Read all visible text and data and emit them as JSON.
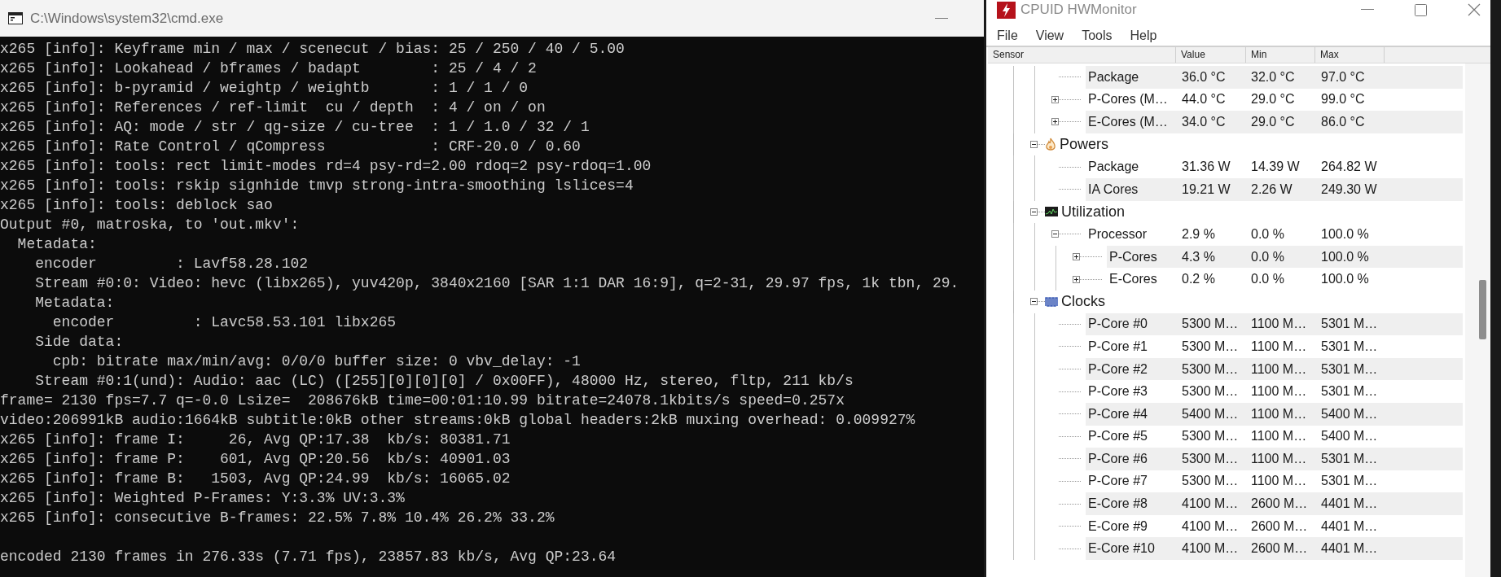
{
  "console": {
    "title": "C:\\Windows\\system32\\cmd.exe",
    "output": [
      "x265 [info]: Keyframe min / max / scenecut / bias: 25 / 250 / 40 / 5.00",
      "x265 [info]: Lookahead / bframes / badapt        : 25 / 4 / 2",
      "x265 [info]: b-pyramid / weightp / weightb       : 1 / 1 / 0",
      "x265 [info]: References / ref-limit  cu / depth  : 4 / on / on",
      "x265 [info]: AQ: mode / str / qg-size / cu-tree  : 1 / 1.0 / 32 / 1",
      "x265 [info]: Rate Control / qCompress            : CRF-20.0 / 0.60",
      "x265 [info]: tools: rect limit-modes rd=4 psy-rd=2.00 rdoq=2 psy-rdoq=1.00",
      "x265 [info]: tools: rskip signhide tmvp strong-intra-smoothing lslices=4",
      "x265 [info]: tools: deblock sao",
      "Output #0, matroska, to 'out.mkv':",
      "  Metadata:",
      "    encoder         : Lavf58.28.102",
      "    Stream #0:0: Video: hevc (libx265), yuv420p, 3840x2160 [SAR 1:1 DAR 16:9], q=2-31, 29.97 fps, 1k tbn, 29.",
      "    Metadata:",
      "      encoder         : Lavc58.53.101 libx265",
      "    Side data:",
      "      cpb: bitrate max/min/avg: 0/0/0 buffer size: 0 vbv_delay: -1",
      "    Stream #0:1(und): Audio: aac (LC) ([255][0][0][0] / 0x00FF), 48000 Hz, stereo, fltp, 211 kb/s",
      "frame= 2130 fps=7.7 q=-0.0 Lsize=  208676kB time=00:01:10.99 bitrate=24078.1kbits/s speed=0.257x",
      "video:206991kB audio:1664kB subtitle:0kB other streams:0kB global headers:2kB muxing overhead: 0.009927%",
      "x265 [info]: frame I:     26, Avg QP:17.38  kb/s: 80381.71",
      "x265 [info]: frame P:    601, Avg QP:20.56  kb/s: 40901.03",
      "x265 [info]: frame B:   1503, Avg QP:24.99  kb/s: 16065.02",
      "x265 [info]: Weighted P-Frames: Y:3.3% UV:3.3%",
      "x265 [info]: consecutive B-frames: 22.5% 7.8% 10.4% 26.2% 33.2%"
    ],
    "summary": "encoded 2130 frames in 276.33s (7.71 fps), 23857.83 kb/s, Avg QP:23.64"
  },
  "hwmonitor": {
    "title": "CPUID HWMonitor",
    "menu": [
      "File",
      "View",
      "Tools",
      "Help"
    ],
    "columns": [
      "Sensor",
      "Value",
      "Min",
      "Max"
    ],
    "tree": [
      {
        "kind": "continued",
        "children": [
          {
            "label": "Package",
            "value": "36.0 °C",
            "min": "32.0 °C",
            "max": "97.0 °C"
          },
          {
            "label": "P-Cores (M…",
            "value": "44.0 °C",
            "min": "29.0 °C",
            "max": "99.0 °C",
            "expanded": false
          },
          {
            "label": "E-Cores (M…",
            "value": "34.0 °C",
            "min": "29.0 °C",
            "max": "86.0 °C",
            "expanded": false
          }
        ]
      },
      {
        "kind": "power",
        "label": "Powers",
        "expanded": true,
        "children": [
          {
            "label": "Package",
            "value": "31.36 W",
            "min": "14.39 W",
            "max": "264.82 W"
          },
          {
            "label": "IA Cores",
            "value": "19.21 W",
            "min": "2.26 W",
            "max": "249.30 W"
          }
        ]
      },
      {
        "kind": "utilization",
        "label": "Utilization",
        "expanded": true,
        "children": [
          {
            "label": "Processor",
            "value": "2.9 %",
            "min": "0.0 %",
            "max": "100.0 %",
            "expanded": true,
            "children": [
              {
                "label": "P-Cores",
                "value": "4.3 %",
                "min": "0.0 %",
                "max": "100.0 %",
                "expanded": false
              },
              {
                "label": "E-Cores",
                "value": "0.2 %",
                "min": "0.0 %",
                "max": "100.0 %",
                "expanded": false
              }
            ]
          }
        ]
      },
      {
        "kind": "clocks",
        "label": "Clocks",
        "expanded": true,
        "children": [
          {
            "label": "P-Core #0",
            "value": "5300 M…",
            "min": "1100 M…",
            "max": "5301 M…"
          },
          {
            "label": "P-Core #1",
            "value": "5300 M…",
            "min": "1100 M…",
            "max": "5301 M…"
          },
          {
            "label": "P-Core #2",
            "value": "5300 M…",
            "min": "1100 M…",
            "max": "5301 M…"
          },
          {
            "label": "P-Core #3",
            "value": "5300 M…",
            "min": "1100 M…",
            "max": "5301 M…"
          },
          {
            "label": "P-Core #4",
            "value": "5400 M…",
            "min": "1100 M…",
            "max": "5400 M…"
          },
          {
            "label": "P-Core #5",
            "value": "5300 M…",
            "min": "1100 M…",
            "max": "5400 M…"
          },
          {
            "label": "P-Core #6",
            "value": "5300 M…",
            "min": "1100 M…",
            "max": "5301 M…"
          },
          {
            "label": "P-Core #7",
            "value": "5300 M…",
            "min": "1100 M…",
            "max": "5301 M…"
          },
          {
            "label": "E-Core #8",
            "value": "4100 M…",
            "min": "2600 M…",
            "max": "4401 M…"
          },
          {
            "label": "E-Core #9",
            "value": "4100 M…",
            "min": "2600 M…",
            "max": "4401 M…"
          },
          {
            "label": "E-Core #10",
            "value": "4100 M…",
            "min": "2600 M…",
            "max": "4401 M…"
          }
        ]
      }
    ]
  }
}
